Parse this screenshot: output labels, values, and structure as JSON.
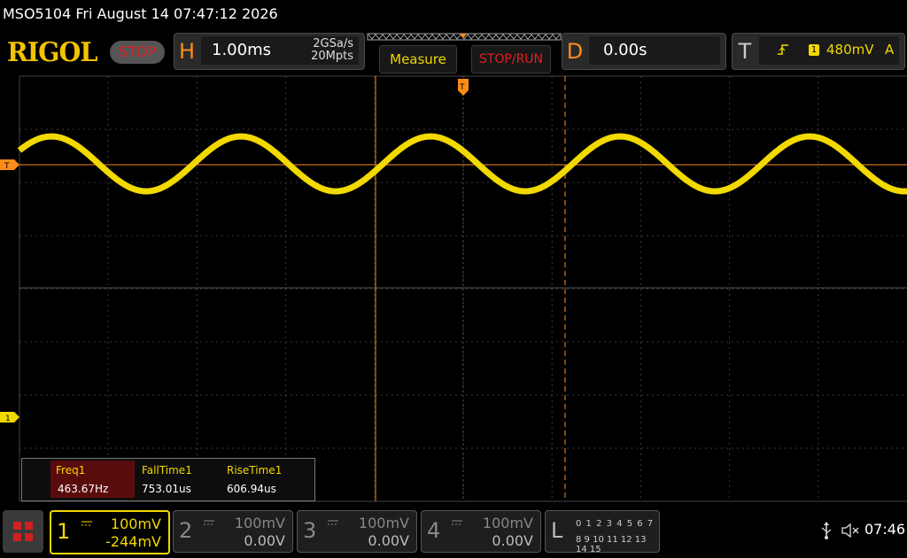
{
  "titlebar": {
    "text": "MSO5104  Fri August 14 07:47:12 2026"
  },
  "toolbar": {
    "logo": "RIGOL",
    "run_state": "STOP",
    "horizontal": {
      "letter": "H",
      "timebase": "1.00ms",
      "sample_rate": "2GSa/s",
      "memory_depth": "20Mpts"
    },
    "measure_label": "Measure",
    "stop_run_label": "STOP/RUN",
    "delay": {
      "letter": "D",
      "value": "0.00s"
    },
    "trigger": {
      "letter": "T",
      "source": "1",
      "level": "480mV",
      "mode": "A",
      "edge": "rising-edge-icon"
    }
  },
  "markers": {
    "trigger_level": "T",
    "channel1": "1",
    "trigger_position": "T"
  },
  "measurements": {
    "headers": [
      "Freq1",
      "FallTime1",
      "RiseTime1"
    ],
    "values": [
      "463.67Hz",
      "753.01us",
      "606.94us"
    ]
  },
  "channels": [
    {
      "number": "1",
      "scale": "100mV",
      "offset": "-244mV",
      "color": "#f2d900",
      "active": true
    },
    {
      "number": "2",
      "scale": "100mV",
      "offset": "0.00V",
      "color": "#888888",
      "active": false
    },
    {
      "number": "3",
      "scale": "100mV",
      "offset": "0.00V",
      "color": "#888888",
      "active": false
    },
    {
      "number": "4",
      "scale": "100mV",
      "offset": "0.00V",
      "color": "#888888",
      "active": false
    }
  ],
  "logic": {
    "letter": "L",
    "row1": "0 1 2 3  4 5 6 7",
    "row2": "8 9 10 11 12 13 14 15"
  },
  "status": {
    "time": "07:46"
  },
  "colors": {
    "trace": "#f2d900",
    "trigger": "#ff8c1a",
    "grid": "#3a3a3a",
    "stop": "#e02020",
    "logo": "#f2c300"
  }
}
